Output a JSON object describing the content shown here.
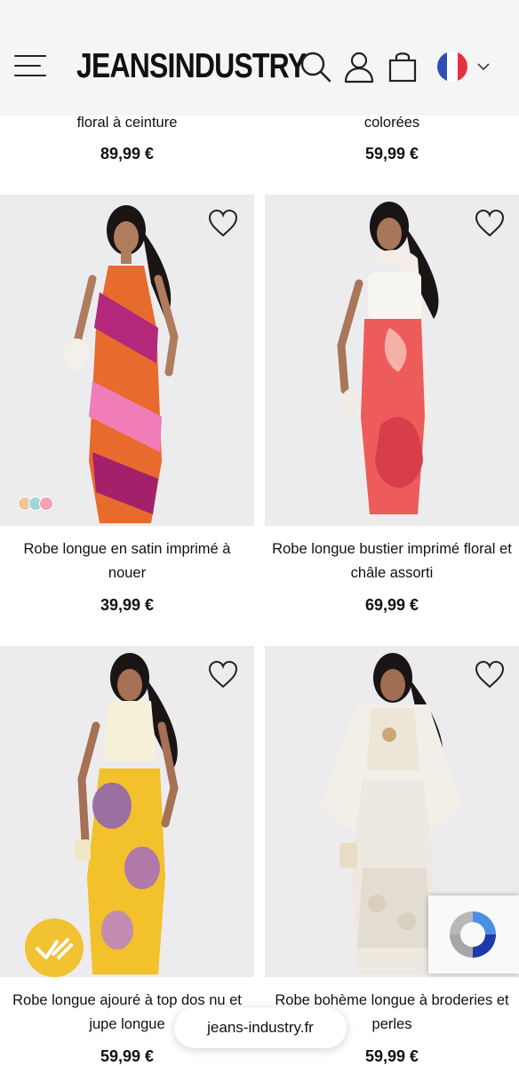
{
  "header": {
    "logo": "JEANSINDUSTRY",
    "icons": [
      "menu-icon",
      "search-icon",
      "account-icon",
      "cart-icon",
      "france-flag-icon",
      "chevron-down-icon"
    ]
  },
  "products": [
    {
      "title": "floral à ceinture",
      "price": "89,99 €"
    },
    {
      "title": "colorées",
      "price": "59,99 €"
    },
    {
      "title": "Robe longue en satin imprimé à nouer",
      "price": "39,99 €",
      "swatches": [
        "#f2c49b",
        "#9fd6dc",
        "#f2a3b3"
      ]
    },
    {
      "title": "Robe longue bustier imprimé floral et châle assorti",
      "price": "69,99 €"
    },
    {
      "title": "Robe longue ajouré à top dos nu et jupe longue",
      "price": "59,99 €"
    },
    {
      "title": "Robe bohème longue à broderies et perles",
      "price": "59,99 €"
    }
  ],
  "browser": {
    "url": "jeans-industry.fr"
  },
  "colors": {
    "header_bg": "#f5f5f5",
    "photo_bg": "#ececef",
    "badge": "#f1c232",
    "flag_blue": "#2b4fb3",
    "flag_white": "#ffffff",
    "flag_red": "#e8313f"
  }
}
